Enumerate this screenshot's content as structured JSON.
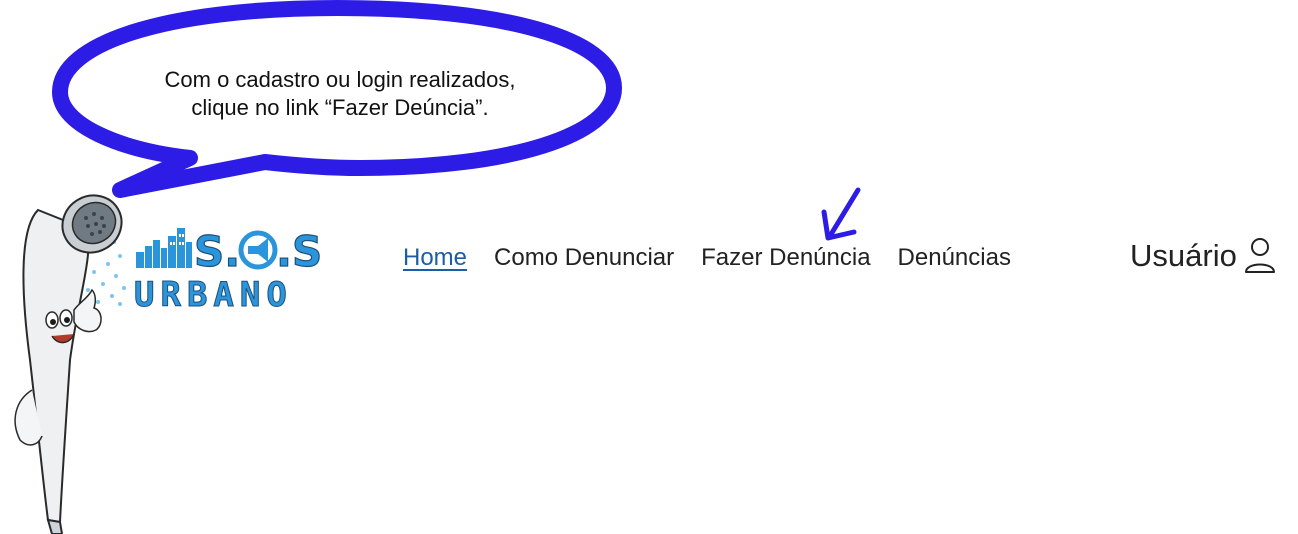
{
  "bubble": {
    "line1": "Com o cadastro ou login realizados,",
    "line2": "clique no link “Fazer Deúncia”."
  },
  "logo": {
    "top_text": "S.O.S",
    "bottom_text": "URBANO",
    "color": "#2b95db"
  },
  "nav": {
    "items": [
      {
        "label": "Home",
        "active": true
      },
      {
        "label": "Como Denunciar"
      },
      {
        "label": "Fazer Denúncia"
      },
      {
        "label": "Denúncias"
      }
    ],
    "active_color": "#1a5ea8"
  },
  "user": {
    "label": "Usuário",
    "icon": "user-icon"
  },
  "accent_color": "#2d1ce6"
}
